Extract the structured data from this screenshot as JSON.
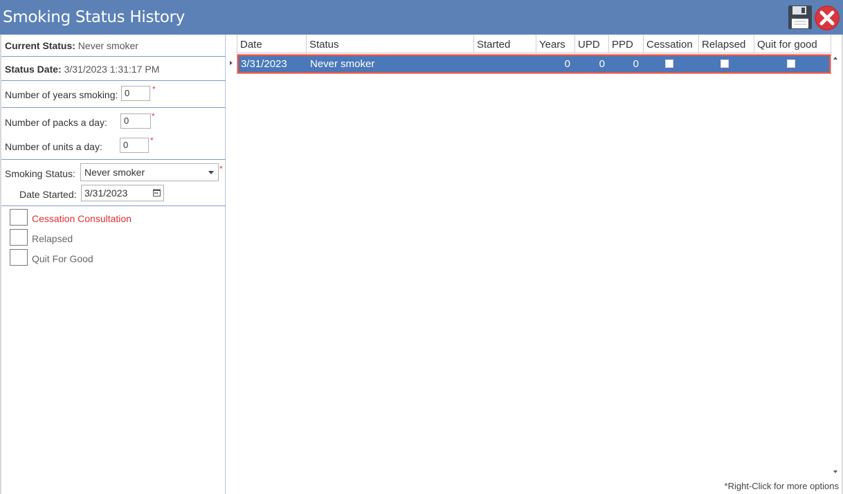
{
  "window": {
    "title": "Smoking Status History"
  },
  "left": {
    "current_status_label": "Current Status:",
    "current_status_value": "Never smoker",
    "status_date_label": "Status Date:",
    "status_date_value": "3/31/2023 1:31:17 PM",
    "years_smoking_label": "Number of years smoking:",
    "years_smoking_value": "0",
    "packs_label": "Number of packs a day:",
    "packs_value": "0",
    "units_label": "Number of units a day:",
    "units_value": "0",
    "required_mark": "*",
    "smoking_status_label": "Smoking Status:",
    "smoking_status_value": "Never smoker",
    "date_started_label": "Date Started:",
    "date_started_value": "3/31/2023",
    "checkboxes": [
      {
        "label": "Cessation Consultation",
        "checked": false
      },
      {
        "label": "Relapsed",
        "checked": false
      },
      {
        "label": "Quit For Good",
        "checked": false
      }
    ]
  },
  "grid": {
    "columns": [
      "Date",
      "Status",
      "Started",
      "Years",
      "UPD",
      "PPD",
      "Cessation",
      "Relapsed",
      "Quit for good"
    ],
    "rows": [
      {
        "date": "3/31/2023",
        "status": "Never smoker",
        "started": "",
        "years": "0",
        "upd": "0",
        "ppd": "0",
        "cessation": false,
        "relapsed": false,
        "quit_for_good": false
      }
    ],
    "hint": "*Right-Click for more options"
  },
  "colors": {
    "titlebar": "#5b81b6",
    "selected_row": "#4a78b8",
    "selection_border": "#e8544a",
    "required": "#e33333"
  }
}
